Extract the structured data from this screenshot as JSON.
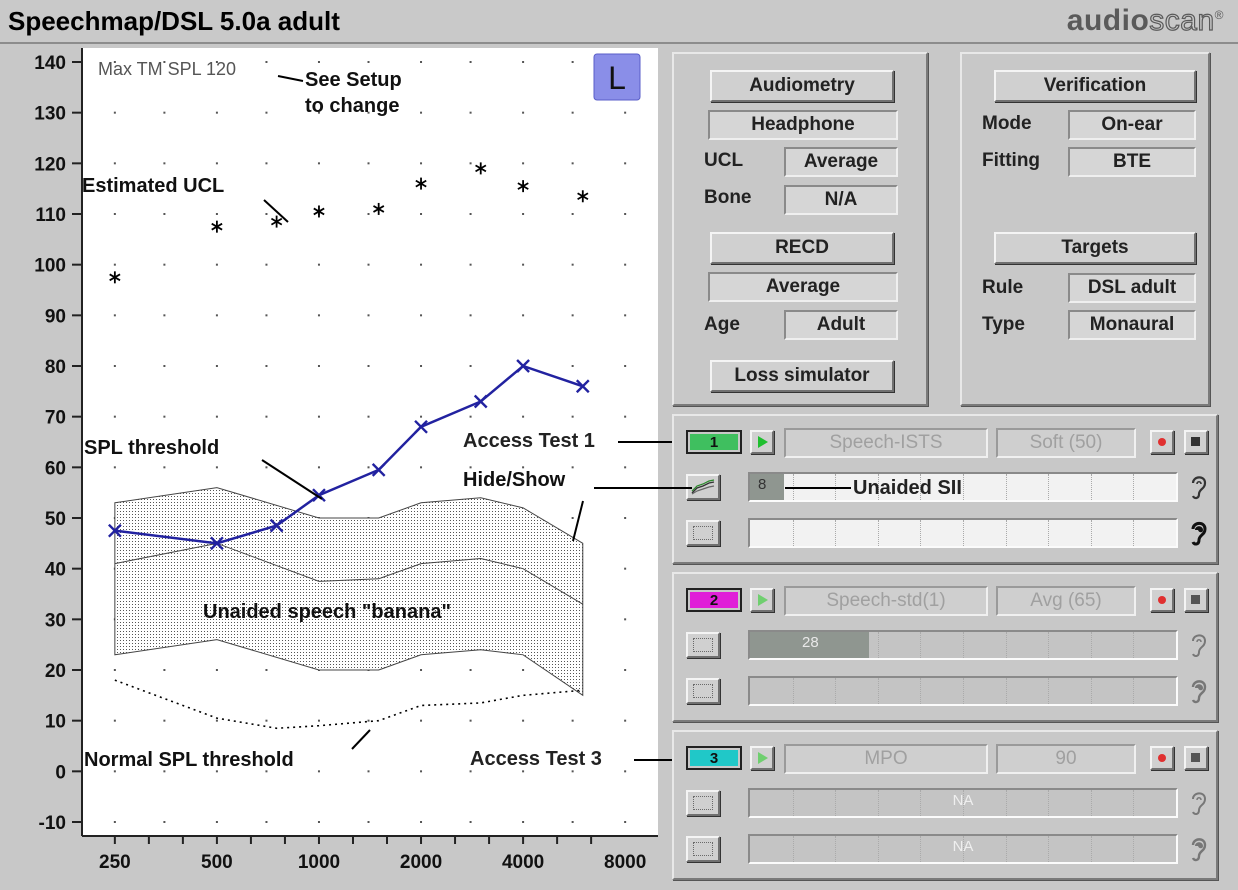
{
  "app": {
    "title": "Speechmap/DSL 5.0a adult",
    "brand_bold": "audio",
    "brand_light": "scan",
    "brand_mark": "®"
  },
  "chart_data": {
    "type": "line",
    "x_scale": "log",
    "x_ticks": [
      250,
      500,
      1000,
      2000,
      4000,
      8000
    ],
    "x_tick_labels": [
      "250",
      "500",
      "1000",
      "2000",
      "4000",
      "8000"
    ],
    "y_ticks": [
      140,
      130,
      120,
      110,
      100,
      90,
      80,
      70,
      60,
      50,
      40,
      30,
      20,
      10,
      0,
      -10
    ],
    "y_tick_labels": [
      "140",
      "130",
      "120",
      "110",
      "100",
      "90",
      "80",
      "70",
      "60",
      "50",
      "40",
      "30",
      "20",
      "10",
      "0",
      "-10"
    ],
    "ylim": [
      -10,
      140
    ],
    "grid": "dotted",
    "ear_badge": "L",
    "series": [
      {
        "kind": "line-x-markers",
        "color": "#2222a0",
        "x": [
          250,
          500,
          750,
          1000,
          1500,
          2000,
          3000,
          4000,
          6000
        ],
        "y": [
          47.5,
          45,
          48.5,
          54.5,
          59.5,
          68,
          73,
          80,
          76
        ]
      },
      {
        "kind": "asterisk-points",
        "color": "#000000",
        "x": [
          250,
          500,
          750,
          1000,
          1500,
          2000,
          3000,
          4000,
          6000
        ],
        "y": [
          97.5,
          107.5,
          108.5,
          110.5,
          111,
          116,
          119,
          115.5,
          113.5
        ]
      },
      {
        "kind": "dotted-line",
        "color": "#000000",
        "x": [
          250,
          500,
          750,
          1000,
          1500,
          2000,
          3000,
          4000,
          6000
        ],
        "y": [
          18,
          10.5,
          8.5,
          9,
          10,
          13,
          13.5,
          15,
          16
        ]
      }
    ],
    "banana": {
      "x": [
        250,
        500,
        1000,
        1500,
        2000,
        3000,
        4000,
        6000
      ],
      "upper": [
        53,
        56,
        50,
        50,
        53,
        54,
        52,
        45
      ],
      "middle": [
        41,
        45,
        37.5,
        38,
        41,
        42,
        40,
        33
      ],
      "lower": [
        23,
        26,
        20,
        20,
        23,
        24,
        23,
        15
      ]
    },
    "annotations": {
      "max_tm": "Max TM SPL 120",
      "see_setup_1": "See Setup",
      "see_setup_2": "to change",
      "estimated_ucl": "Estimated UCL",
      "spl_threshold": "SPL threshold",
      "hide_show": "Hide/Show",
      "unaided_banana": "Unaided speech \"banana\"",
      "normal_spl": "Normal SPL threshold",
      "access_test_1": "Access Test 1",
      "unaided_sii": "Unaided SII",
      "access_test_3": "Access Test 3"
    }
  },
  "audiometry": {
    "button": "Audiometry",
    "transducer": "Headphone",
    "ucl_label": "UCL",
    "ucl_value": "Average",
    "bone_label": "Bone",
    "bone_value": "N/A",
    "recd_button": "RECD",
    "recd_value": "Average",
    "age_label": "Age",
    "age_value": "Adult",
    "loss_sim_button": "Loss simulator"
  },
  "verification": {
    "button": "Verification",
    "mode_label": "Mode",
    "mode_value": "On-ear",
    "fitting_label": "Fitting",
    "fitting_value": "BTE",
    "targets_button": "Targets",
    "rule_label": "Rule",
    "rule_value": "DSL adult",
    "type_label": "Type",
    "type_value": "Monaural"
  },
  "tests": [
    {
      "number": "1",
      "color": "#3fbf5f",
      "stimulus": "Speech-ISTS",
      "level": "Soft (50)",
      "sii_value": "8",
      "sii_fraction": 0.08,
      "bars_dim": false
    },
    {
      "number": "2",
      "color": "#e020d8",
      "stimulus": "Speech-std(1)",
      "level": "Avg (65)",
      "sii_value": "28",
      "sii_fraction": 0.28,
      "bars_dim": true
    },
    {
      "number": "3",
      "color": "#20c8c8",
      "stimulus": "MPO",
      "level": "90",
      "row1_text": "NA",
      "row2_text": "NA",
      "bars_dim": true
    }
  ]
}
